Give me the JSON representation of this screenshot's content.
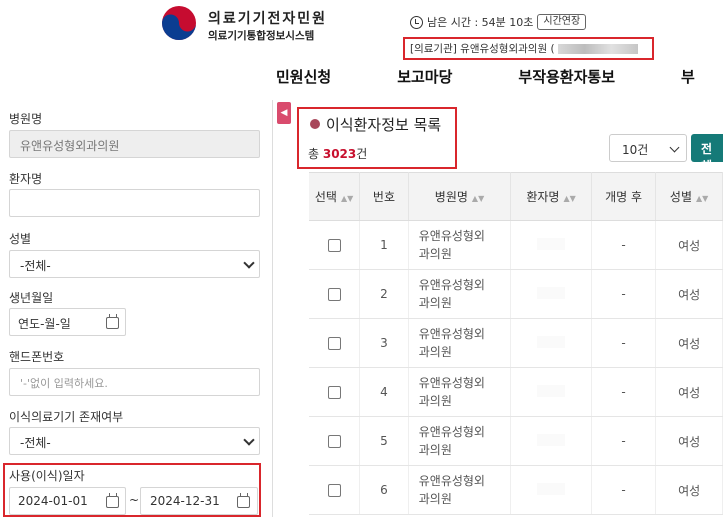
{
  "header": {
    "logo_title": "의료기기전자민원",
    "logo_subtitle": "의료기기통합정보시스템",
    "session_label": "남은 시간 : 54분 10초",
    "extend_label": "시간연장",
    "institution_label": "[의료기관] 유앤유성형외과의원 ("
  },
  "nav": {
    "items": [
      "민원신청",
      "보고마당",
      "부작용환자통보",
      "부"
    ]
  },
  "search": {
    "hospital_label": "병원명",
    "hospital_value": "유앤유성형외과의원",
    "patient_label": "환자명",
    "patient_value": "",
    "gender_label": "성별",
    "gender_value": "-전체-",
    "birth_label": "생년월일",
    "birth_value": "연도-월-일",
    "phone_label": "핸드폰번호",
    "phone_placeholder": "'-'없이 입력하세요.",
    "device_label": "이식의료기기 존재여부",
    "device_value": "-전체-",
    "use_date_label": "사용(이식)일자",
    "date_from": "2024-01-01",
    "date_sep": "~",
    "date_to": "2024-12-31"
  },
  "main": {
    "title": "이식환자정보 목록",
    "total_prefix": "총 ",
    "total_count": "3023",
    "total_suffix": "건",
    "page_size": "10건",
    "all_button": "전체",
    "collapse_icon": "◀",
    "columns": [
      "선택",
      "번호",
      "병원명",
      "환자명",
      "개명 후",
      "성별"
    ],
    "rows": [
      {
        "no": "1",
        "hospital": [
          "유앤유성형외",
          "과의원"
        ],
        "patient": "",
        "renamed": "-",
        "gender": "여성"
      },
      {
        "no": "2",
        "hospital": [
          "유앤유성형외",
          "과의원"
        ],
        "patient": "",
        "renamed": "-",
        "gender": "여성"
      },
      {
        "no": "3",
        "hospital": [
          "유앤유성형외",
          "과의원"
        ],
        "patient": "",
        "renamed": "-",
        "gender": "여성"
      },
      {
        "no": "4",
        "hospital": [
          "유앤유성형외",
          "과의원"
        ],
        "patient": "",
        "renamed": "-",
        "gender": "여성"
      },
      {
        "no": "5",
        "hospital": [
          "유앤유성형외",
          "과의원"
        ],
        "patient": "",
        "renamed": "-",
        "gender": "여성"
      },
      {
        "no": "6",
        "hospital": [
          "유앤유성형외",
          "과의원"
        ],
        "patient": "",
        "renamed": "-",
        "gender": "여성"
      }
    ]
  },
  "colors": {
    "highlight": "#d9262c",
    "accent": "#157a78",
    "count": "#c8102e"
  }
}
